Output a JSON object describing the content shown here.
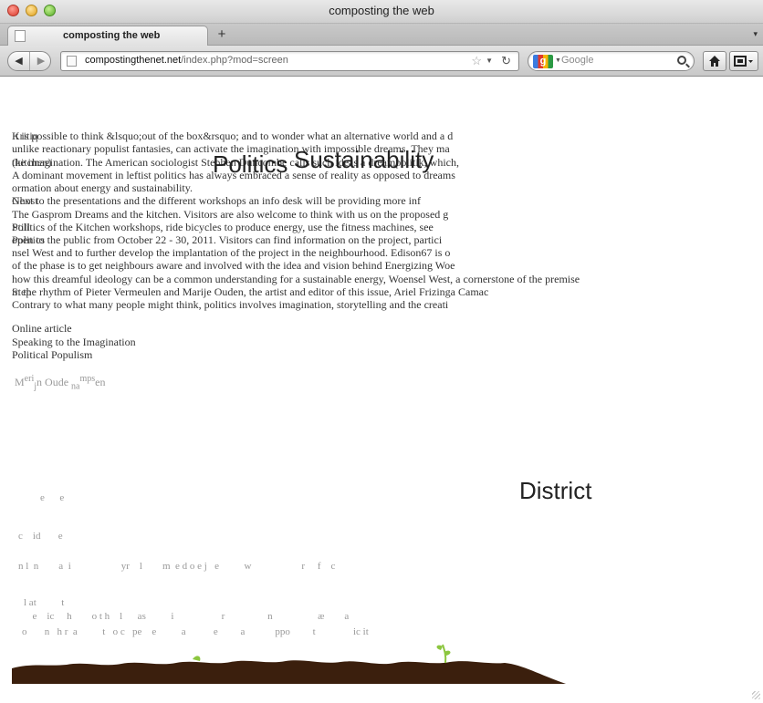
{
  "window": {
    "title": "composting the web"
  },
  "tabs": [
    {
      "label": "composting the web",
      "active": true
    }
  ],
  "tabbar": {
    "new_tab_label": "+",
    "overflow_label": "▾"
  },
  "toolbar": {
    "back_label": "◀",
    "forward_label": "▶",
    "url_host": "compostingthenet.net",
    "url_path": "/index.php?mod=screen",
    "search_placeholder": "Google",
    "search_engine_label": "g",
    "home_icon": "home-icon",
    "bookmarks_icon": "bookmarks-menu-icon"
  },
  "page": {
    "overlapping_lines": [
      {
        "text": "It is possible to think &lsquo;out of the box&rsquo; and to wonder what an alternative world and a d"
      },
      {
        "text": "unlike reactionary populist fantasies, can activate the imagination with impossible dreams. They ma"
      },
      {
        "text": "the imagination. The American sociologist Stephen Duncombe calls such ideas a dreampolitik, which,"
      },
      {
        "text": "A dominant movement in leftist politics has always embraced a sense of reality as opposed to dreams"
      },
      {
        "text": "ormation about energy and sustainability."
      },
      {
        "text": "Next to the presentations and the different workshops an info desk will be providing more inf"
      },
      {
        "text": "The Gasprom Dreams and the kitchen. Visitors are also welcome to think with us on the proposed g"
      },
      {
        "text": "Politics of the Kitchen workshops, ride bicycles to produce energy, use the fitness machines, see"
      },
      {
        "text": "open to the public from October 22 - 30, 2011. Visitors can find information on the project, partici"
      },
      {
        "text": "nsel West and to further develop the implantation of the project in the neighbourhood. Edison67 is o"
      },
      {
        "text": "of the phase is to get neighbours aware and involved with the idea and vision behind Energizing Woe"
      },
      {
        "text": "how this dreamful ideology can be a common understanding for a sustainable energy, Woensel West, a cornerstone of the premise"
      },
      {
        "text": "in the rhythm of Pieter Vermeulen and Marije Ouden, the artist and editor of this issue, Ariel Frizinga Camac"
      },
      {
        "text": "Contrary to what many people might think, politics involves imagination, storytelling and the creati"
      }
    ],
    "overprint_words": [
      "Kritiq",
      "(kitchen)",
      "Ghost",
      "Still",
      "Politics",
      "Step"
    ],
    "big_words": [
      "Politics",
      "Sustainability",
      "District"
    ],
    "links": [
      "Online article",
      "Speaking to the Imagination",
      "Political Populism"
    ],
    "author_parts": [
      "M",
      "e",
      "r",
      "i",
      "j",
      "n Oude",
      "na",
      "m",
      "ps",
      "en"
    ],
    "scattered_letter_lines": [
      "e      e",
      "c    id       e",
      "n l  n        a  i                    yr    l        m  e d o e j   e          w                    r     f    c",
      "l at          t",
      "  e    ic     h        o t h    l      as          i                   r                 n                  æ        a",
      "o       n   h r  a          t   o c   pe    e          a           e         a            ppo         t               ic it"
    ]
  },
  "colors": {
    "soil": "#3b1f0d",
    "sprout": "#8cc63f",
    "text": "#333333",
    "faded_text": "#999999"
  }
}
